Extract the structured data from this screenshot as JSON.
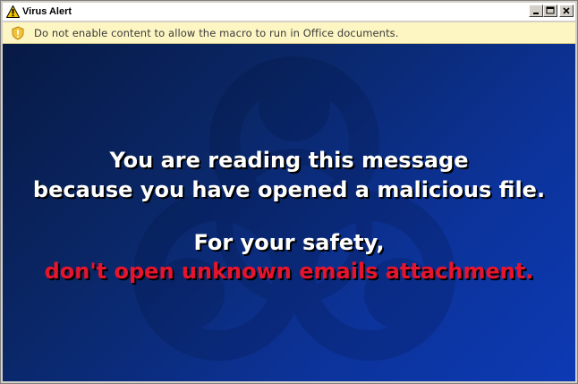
{
  "window": {
    "title": "Virus Alert",
    "title_icon": "warning-triangle-icon",
    "buttons": [
      "minimize",
      "maximize",
      "close"
    ]
  },
  "infobar": {
    "icon": "exclamation-shield-icon",
    "text": "Do not enable content to allow the macro to run in Office documents."
  },
  "message": {
    "line1": "You are reading this message",
    "line2": "because you have opened a malicious file.",
    "line3": "For your safety,",
    "line4": "don't open unknown emails attachment."
  },
  "colors": {
    "background_dark": "#071a44",
    "background_light": "#0d3ab4",
    "text_primary": "#ffffff",
    "text_warning": "#e8142d",
    "infobar_bg": "#fdf6c3"
  },
  "background_icon": "biohazard-icon"
}
